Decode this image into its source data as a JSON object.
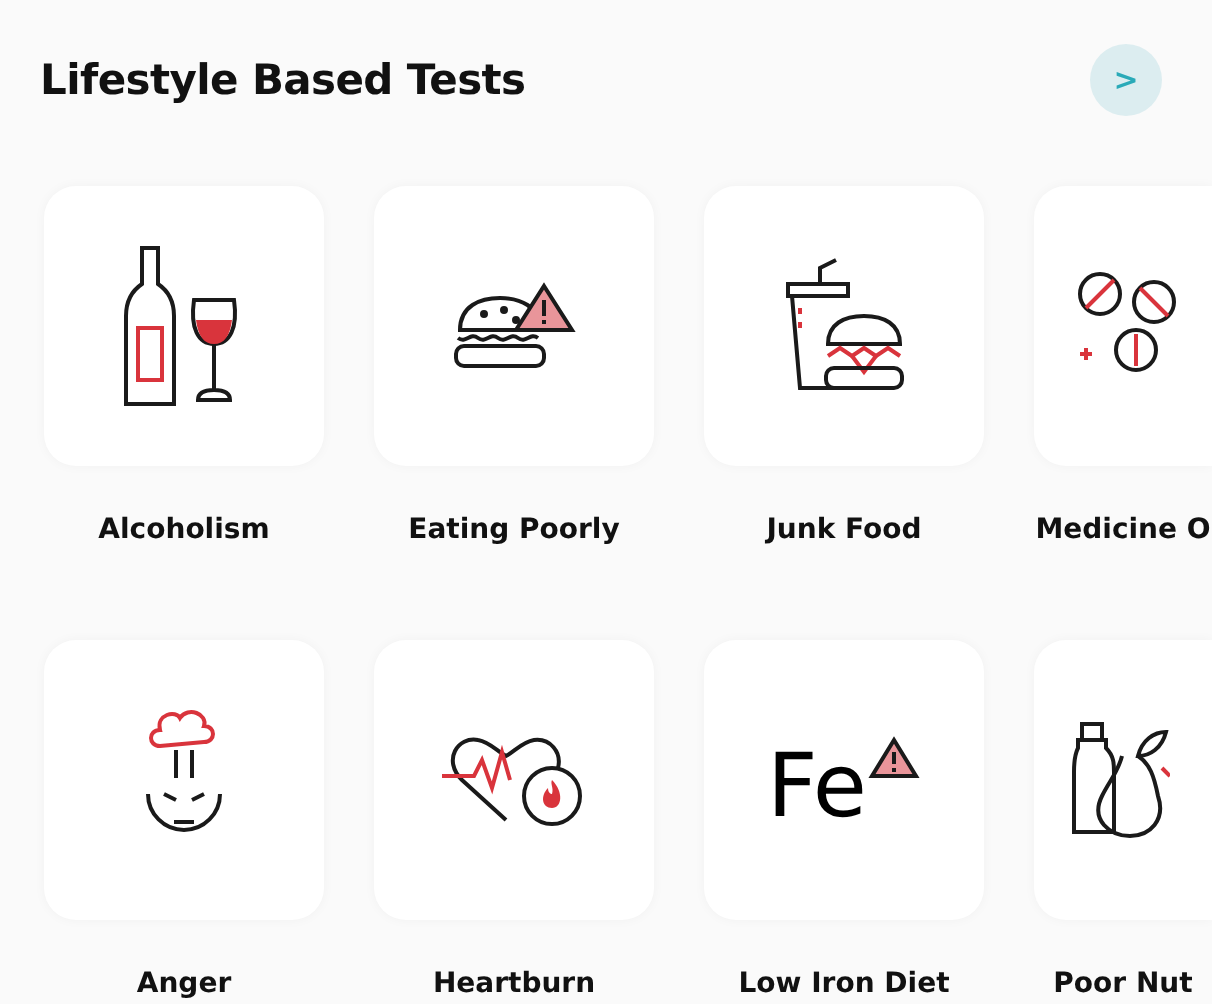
{
  "header": {
    "title": "Lifestyle Based Tests",
    "next_button": ">"
  },
  "tests": [
    {
      "label": "Alcoholism",
      "kind": "wine"
    },
    {
      "label": "Eating Poorly",
      "kind": "burger-warning"
    },
    {
      "label": "Junk Food",
      "kind": "fastfood"
    },
    {
      "label": "Medicine O",
      "kind": "pills"
    },
    {
      "label": "Anger",
      "kind": "angry-face"
    },
    {
      "label": "Heartburn",
      "kind": "heart-fire"
    },
    {
      "label": "Low Iron Diet",
      "kind": "iron",
      "icon_text": "Fe"
    },
    {
      "label": "Poor Nut",
      "kind": "fruit-bottle"
    }
  ]
}
